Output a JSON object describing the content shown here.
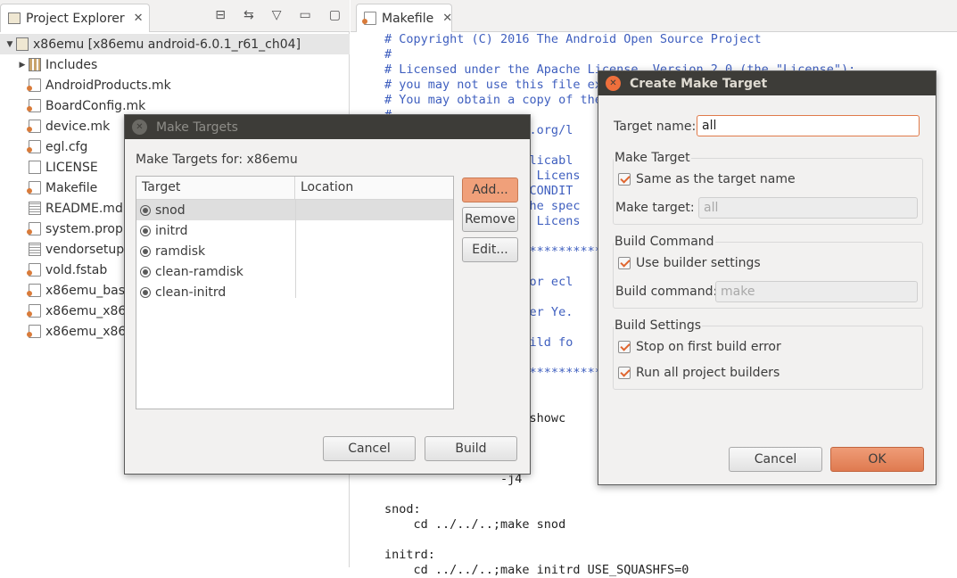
{
  "explorer": {
    "tab_label": "Project Explorer",
    "tab_close": "✕",
    "tree": [
      {
        "label": "x86emu [x86emu android-6.0.1_r61_ch04]",
        "icon": "project-icon",
        "twisty": "▼",
        "root": true
      },
      {
        "label": "Includes",
        "icon": "library-icon",
        "twisty": "▶"
      },
      {
        "label": "AndroidProducts.mk",
        "icon": "file-icon"
      },
      {
        "label": "BoardConfig.mk",
        "icon": "file-icon"
      },
      {
        "label": "device.mk",
        "icon": "file-icon"
      },
      {
        "label": "egl.cfg",
        "icon": "file-icon"
      },
      {
        "label": "LICENSE",
        "icon": "plain-file-icon"
      },
      {
        "label": "Makefile",
        "icon": "file-icon"
      },
      {
        "label": "README.md",
        "icon": "text-file-icon"
      },
      {
        "label": "system.prop",
        "icon": "file-icon"
      },
      {
        "label": "vendorsetup",
        "icon": "text-file-icon"
      },
      {
        "label": "vold.fstab",
        "icon": "file-icon"
      },
      {
        "label": "x86emu_bas",
        "icon": "file-icon"
      },
      {
        "label": "x86emu_x86",
        "icon": "file-icon"
      },
      {
        "label": "x86emu_x86",
        "icon": "file-icon"
      }
    ]
  },
  "editor": {
    "tab_label": "Makefile",
    "tab_close": "✕",
    "lines": [
      {
        "text": "# Copyright (C) 2016 The Android Open Source Project",
        "kind": "comment"
      },
      {
        "text": "#",
        "kind": "comment"
      },
      {
        "text": "# Licensed under the Apache License, Version 2.0 (the \"License\");",
        "kind": "comment"
      },
      {
        "text": "# you may not use this file ex",
        "kind": "comment"
      },
      {
        "text": "# You may obtain a copy of the",
        "kind": "comment"
      },
      {
        "text": "#",
        "kind": "comment"
      },
      {
        "text": "                ache.org/l",
        "kind": "comment"
      },
      {
        "text": "",
        "kind": "comment"
      },
      {
        "text": "                 applicabl",
        "kind": "comment"
      },
      {
        "text": "                 the Licens",
        "kind": "comment"
      },
      {
        "text": "                 OR CONDIT",
        "kind": "comment"
      },
      {
        "text": "                 r the spec",
        "kind": "comment"
      },
      {
        "text": "                 the Licens",
        "kind": "comment"
      },
      {
        "text": "",
        "kind": "comment"
      },
      {
        "text": "                 *******************************************************",
        "kind": "comment"
      },
      {
        "text": "",
        "kind": "comment"
      },
      {
        "text": "                le for ecl",
        "kind": "comment"
      },
      {
        "text": "",
        "kind": "comment"
      },
      {
        "text": "                 Roger Ye.",
        "kind": "comment"
      },
      {
        "text": "",
        "kind": "comment"
      },
      {
        "text": "                e build fo",
        "kind": "comment"
      },
      {
        "text": "",
        "kind": "comment"
      },
      {
        "text": "                 *******************************************************",
        "kind": "comment"
      },
      {
        "text": "",
        "kind": "plain"
      },
      {
        "text": "",
        "kind": "plain"
      },
      {
        "text": "                -j8 showc",
        "kind": "plain"
      },
      {
        "text": "",
        "kind": "plain"
      },
      {
        "text": "",
        "kind": "plain"
      },
      {
        "text": "",
        "kind": "plain"
      },
      {
        "text": "                -j4",
        "kind": "plain"
      },
      {
        "text": "",
        "kind": "plain"
      },
      {
        "text": "snod:",
        "kind": "plain"
      },
      {
        "text": "    cd ../../..;make snod",
        "kind": "plain"
      },
      {
        "text": "",
        "kind": "plain"
      },
      {
        "text": "initrd:",
        "kind": "plain"
      },
      {
        "text": "    cd ../../..;make initrd USE_SQUASHFS=0",
        "kind": "plain"
      }
    ]
  },
  "make_targets": {
    "title": "Make Targets",
    "close": "✕",
    "for_label": "Make Targets for: x86emu",
    "columns": [
      "Target",
      "Location"
    ],
    "rows": [
      "snod",
      "initrd",
      "ramdisk",
      "clean-ramdisk",
      "clean-initrd"
    ],
    "buttons": {
      "add": "Add...",
      "remove": "Remove",
      "edit": "Edit...",
      "cancel": "Cancel",
      "build": "Build"
    }
  },
  "create_target": {
    "title": "Create Make Target",
    "close": "✕",
    "target_name_label": "Target name:",
    "target_name_value": "all",
    "make_target_group": "Make Target",
    "same_as_name": "Same as the target name",
    "make_target_label": "Make target:",
    "make_target_value": "all",
    "build_command_group": "Build Command",
    "use_builder": "Use builder settings",
    "build_command_label": "Build command:",
    "build_command_value": "make",
    "build_settings_group": "Build Settings",
    "stop_on_error": "Stop on first build error",
    "run_all": "Run all project builders",
    "cancel": "Cancel",
    "ok": "OK"
  },
  "colors": {
    "accent": "#df7a50",
    "title_bar": "#3d3c38",
    "comment": "#3f5fbf"
  }
}
